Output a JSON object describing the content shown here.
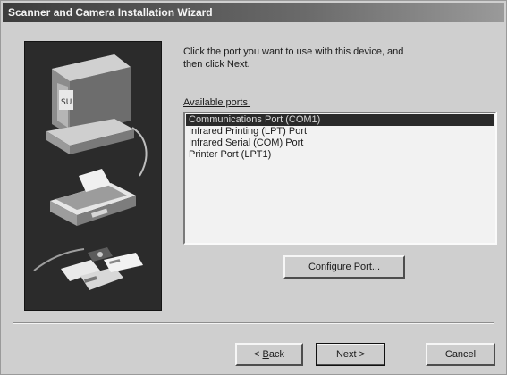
{
  "window": {
    "title": "Scanner and Camera Installation Wizard"
  },
  "instruction": {
    "line1": "Click the port you want to use with this device, and",
    "line2": "then click Next."
  },
  "ports": {
    "label": "Available ports:",
    "items": [
      {
        "label": "Communications Port (COM1)",
        "selected": true
      },
      {
        "label": "Infrared Printing (LPT) Port",
        "selected": false
      },
      {
        "label": "Infrared Serial (COM) Port",
        "selected": false
      },
      {
        "label": "Printer Port (LPT1)",
        "selected": false
      }
    ]
  },
  "buttons": {
    "configure_ul": "C",
    "configure_rest": "onfigure Port...",
    "back_prefix": "< ",
    "back_ul": "B",
    "back_rest": "ack",
    "next": "Next >",
    "cancel": "Cancel"
  },
  "illustration": {
    "icons": [
      "computer-icon",
      "scanner-icon",
      "camera-photos-icon"
    ]
  }
}
